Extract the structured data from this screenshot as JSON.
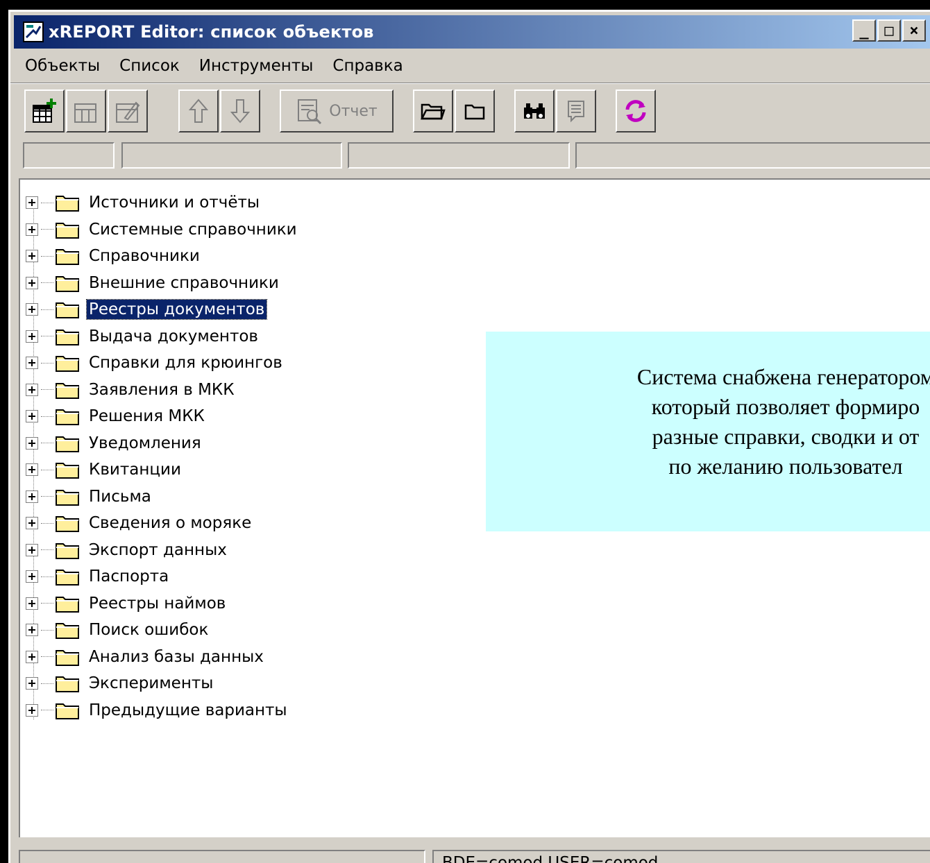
{
  "window": {
    "title": "xREPORT Editor: список объектов",
    "caption_buttons": [
      "_",
      "□",
      "×"
    ]
  },
  "menu": {
    "items": [
      "Объекты",
      "Список",
      "Инструменты",
      "Справка"
    ]
  },
  "toolbar": {
    "report_label": "Отчет",
    "buttons": [
      {
        "icon": "add-table-icon",
        "enabled": true
      },
      {
        "icon": "table-icon",
        "enabled": false
      },
      {
        "icon": "edit-table-icon",
        "enabled": false
      },
      {
        "icon": "arrow-up-icon",
        "enabled": false
      },
      {
        "icon": "arrow-down-icon",
        "enabled": false
      },
      {
        "icon": "report-icon",
        "enabled": false
      },
      {
        "icon": "folder-open-icon",
        "enabled": true
      },
      {
        "icon": "folder-icon",
        "enabled": true
      },
      {
        "icon": "binoculars-icon",
        "enabled": true
      },
      {
        "icon": "comment-icon",
        "enabled": false
      },
      {
        "icon": "refresh-icon",
        "enabled": true
      }
    ]
  },
  "tree": {
    "selected_index": 4,
    "items": [
      "Источники и отчёты",
      "Системные справочники",
      "Справочники",
      "Внешние справочники",
      "Реестры документов",
      "Выдача документов",
      "Справки для крюингов",
      "Заявления в МКК",
      "Решения МКК",
      "Уведомления",
      "Квитанции",
      "Письма",
      "Сведения о моряке",
      "Экспорт данных",
      "Паспорта",
      "Реестры наймов",
      "Поиск ошибок",
      "Анализ базы данных",
      "Эксперименты",
      "Предыдущие варианты"
    ]
  },
  "callout": {
    "lines": [
      "Система снабжена генератором",
      "который позволяет формиро",
      "разные справки, сводки и от",
      "по желанию пользовател"
    ]
  },
  "status": {
    "text": "BDE=comod  USER=comod"
  },
  "colors": {
    "title_bar": "#0a246a",
    "selection": "#0a246a",
    "callout_bg": "#ccffff",
    "face": "#d4d0c8",
    "folder": "#ffef9c"
  }
}
